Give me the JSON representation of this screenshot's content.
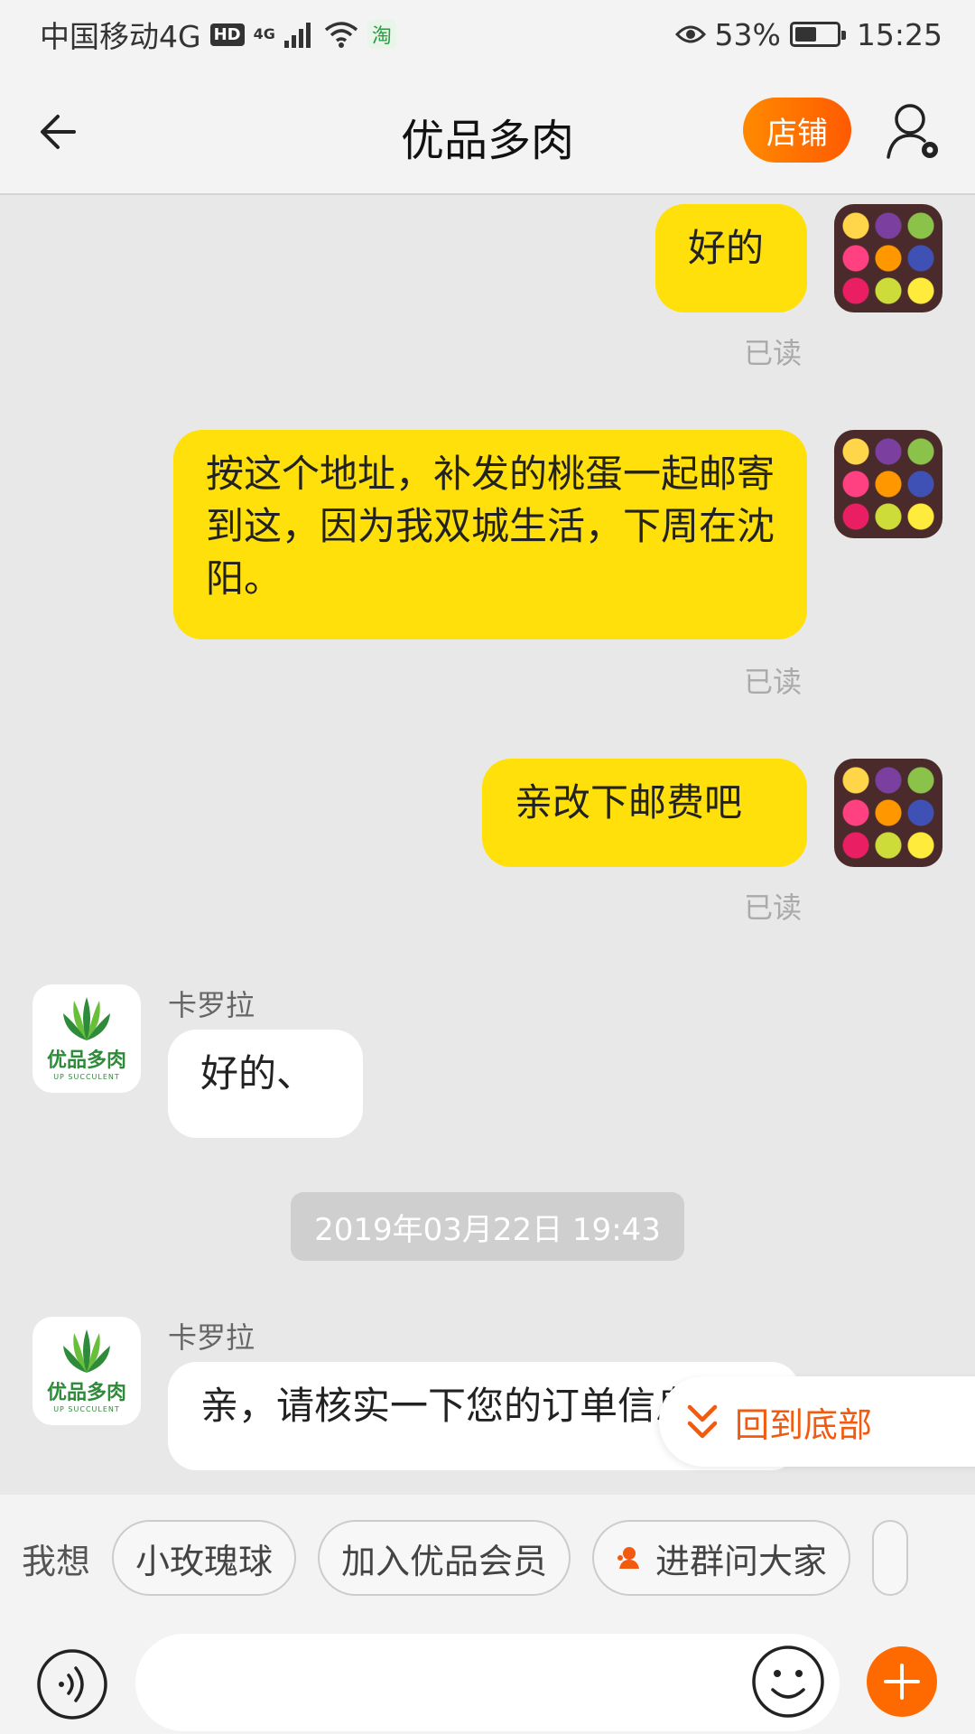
{
  "status": {
    "carrier": "中国移动4G",
    "hd": "HD",
    "network": "4G",
    "battery_pct": "53%",
    "battery_level": 0.53,
    "time": "15:25",
    "app_badge": "淘"
  },
  "header": {
    "title": "优品多肉",
    "shop_button": "店铺"
  },
  "messages": {
    "m1": {
      "text": "好的",
      "status": "已读"
    },
    "m2": {
      "text": "按这个地址，补发的桃蛋一起邮寄到这，因为我双城生活，下周在沈阳。",
      "status": "已读"
    },
    "m3": {
      "text": "亲改下邮费吧",
      "status": "已读"
    },
    "r1": {
      "sender": "卡罗拉",
      "text": "好的、"
    },
    "timestamp": "2019年03月22日 19:43",
    "r2": {
      "sender": "卡罗拉",
      "text": "亲，请核实一下您的订单信息"
    }
  },
  "shop_logo": {
    "name": "优品多肉",
    "sub": "UP SUCCULENT"
  },
  "back_to_bottom": "回到底部",
  "quick_replies": {
    "label": "我想",
    "chips": [
      "小玫瑰球",
      "加入优品会员",
      "进群问大家"
    ]
  },
  "input": {
    "placeholder": ""
  },
  "colors": {
    "accent": "#ff6a00",
    "my_bubble": "#ffe00a",
    "brand_green": "#2e8b3a"
  }
}
